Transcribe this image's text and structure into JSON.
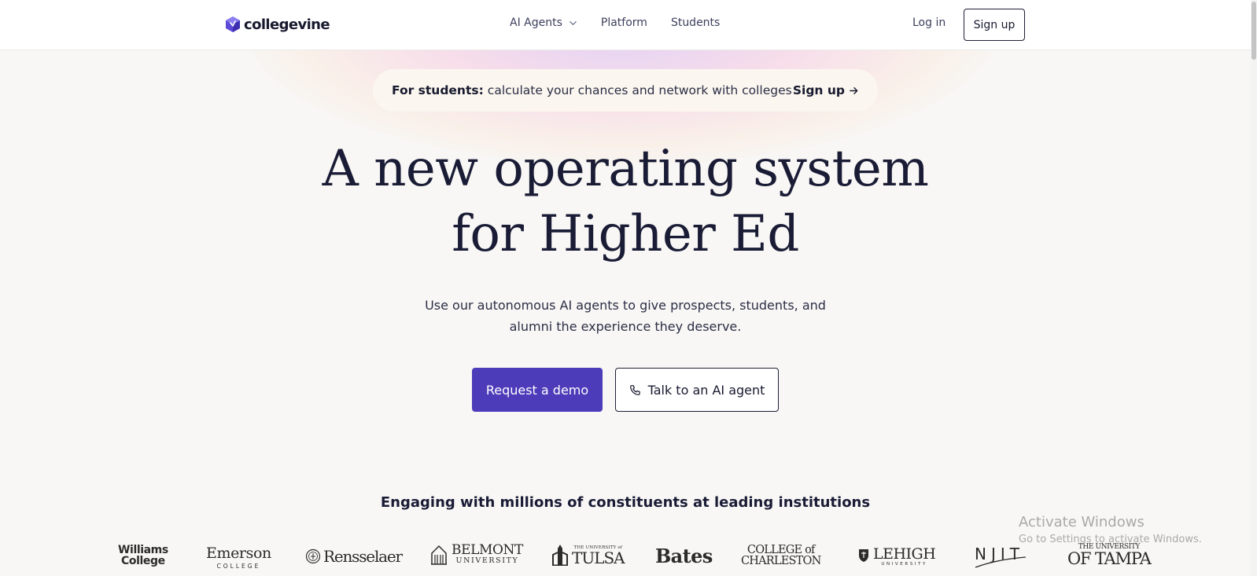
{
  "nav": {
    "brand": "collegevine",
    "menu": [
      {
        "label": "AI Agents",
        "has_dropdown": true
      },
      {
        "label": "Platform"
      },
      {
        "label": "Students"
      }
    ],
    "login_label": "Log in",
    "signup_label": "Sign up"
  },
  "announcement": {
    "strong": "For students:",
    "text": "calculate your chances and network with colleges",
    "link_label": "Sign up"
  },
  "hero": {
    "headline_lines": [
      "A new operating system",
      "for Higher Ed"
    ],
    "subtitle_lines": [
      "Use our autonomous AI agents to give prospects, students, and",
      "alumni the experience they deserve."
    ],
    "primary_cta": "Request a demo",
    "secondary_cta": "Talk to an AI agent"
  },
  "institutions": {
    "heading": "Engaging with millions of constituents at leading institutions",
    "logos": {
      "williams": {
        "line1": "Williams",
        "line2": "College"
      },
      "emerson": {
        "line1": "Emerson",
        "line2": "COLLEGE"
      },
      "rensselaer": {
        "name": "Rensselaer"
      },
      "belmont": {
        "line1": "BELMONT",
        "line2": "UNIVERSITY"
      },
      "tulsa": {
        "line1": "THE UNIVERSITY of",
        "line2": "TULSA"
      },
      "bates": {
        "name": "Bates"
      },
      "charleston": {
        "line1": "COLLEGE of",
        "line2": "CHARLESTON"
      },
      "lehigh": {
        "line1": "LEHIGH",
        "line2": "UNIVERSITY"
      },
      "njit": {
        "name": "NJIT"
      },
      "tampa": {
        "line1": "THE UNIVERSITY",
        "line2": "OF TAMPA"
      }
    }
  },
  "watermark": {
    "title": "Activate Windows",
    "subtitle": "Go to Settings to activate Windows."
  },
  "colors": {
    "brand_purple": "#4c3cb9",
    "logo_purple": "#5b4bd6",
    "text_dark": "#1a1c36",
    "page_bg": "#f8f7f5"
  },
  "icons": {
    "brand": "collegevine-hexagon-icon",
    "dropdown": "chevron-down-icon",
    "announcement_link": "arrow-right-icon",
    "secondary_cta": "phone-icon"
  }
}
